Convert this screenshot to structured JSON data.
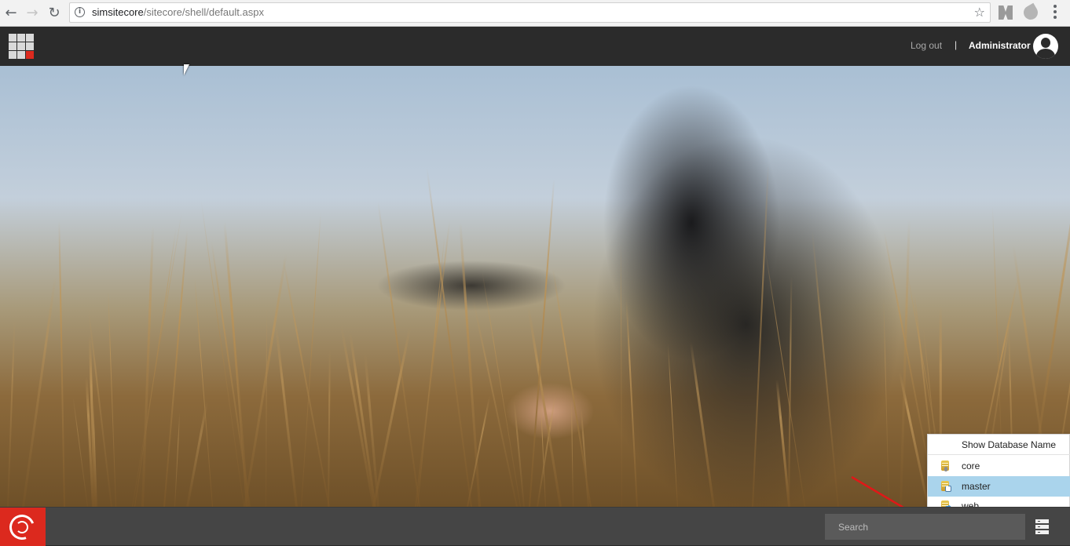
{
  "browser": {
    "url_host": "simsitecore",
    "url_path": "/sitecore/shell/default.aspx",
    "icons": {
      "back": "back-arrow-icon",
      "forward": "forward-arrow-icon",
      "reload": "reload-icon",
      "info": "info-icon",
      "bookmark": "star-icon",
      "menu": "vertical-dots-menu-icon"
    }
  },
  "header": {
    "logout_label": "Log out",
    "separator": "|",
    "user_name": "Administrator",
    "colors": {
      "bar": "#2b2b2b",
      "accent": "#dc2a1e"
    }
  },
  "database_menu": {
    "title": "Show Database Name",
    "items": [
      {
        "label": "core",
        "icon": "core-database-icon",
        "selected": false
      },
      {
        "label": "master",
        "icon": "master-database-icon",
        "selected": true
      },
      {
        "label": "web",
        "icon": "web-database-icon",
        "selected": false
      }
    ],
    "selected_color": "#aad4ec"
  },
  "taskbar": {
    "search_placeholder": "Search",
    "start_color": "#dc291e"
  }
}
